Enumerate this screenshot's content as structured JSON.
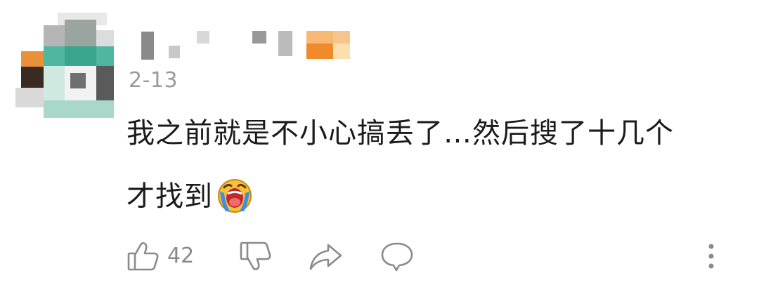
{
  "comment": {
    "date": "2-13",
    "text_line1": "我之前就是不小心搞丢了…然后搜了十几个",
    "text_line2": "才找到",
    "emoji": "crying-face-icon"
  },
  "actions": {
    "like_count": "42",
    "like_icon": "thumbs-up-icon",
    "dislike_icon": "thumbs-down-icon",
    "share_icon": "share-arrow-icon",
    "reply_icon": "comment-bubble-icon",
    "more_icon": "more-vertical-icon"
  },
  "colors": {
    "text": "#1b1b1b",
    "muted": "#9a9a9a",
    "icon": "#8a8a8a"
  }
}
